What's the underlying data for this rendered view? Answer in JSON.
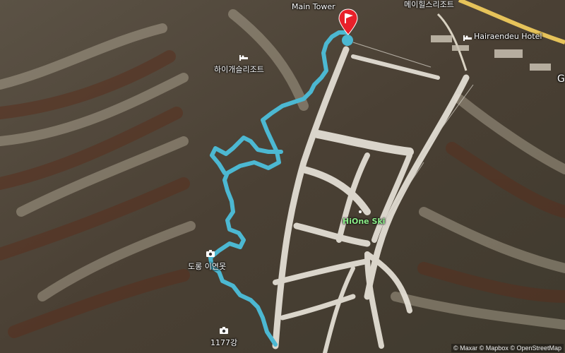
{
  "labels": {
    "main_tower": "Main Tower",
    "mayhills_resort": "메이힐스리조트",
    "hairaendeu_hotel": "Hairaendeu Hotel",
    "high1_resort": "하이개슬리조트",
    "hione_ski": "HiOne Ski",
    "dodong_park": "도롱 이연못",
    "peak_1177": "1177강",
    "edge_g": "G"
  },
  "attribution": "© Maxar © Mapbox © OpenStreetMap",
  "colors": {
    "route": "#4cb8d2",
    "flag": "#e8202a",
    "road": "#e6c35a",
    "ski_slope": "#e7e2d8",
    "label_green": "#8ef08a"
  },
  "icons": {
    "finish_flag": "flag-icon",
    "hotel": "hotel-icon",
    "camera": "camera-icon"
  }
}
